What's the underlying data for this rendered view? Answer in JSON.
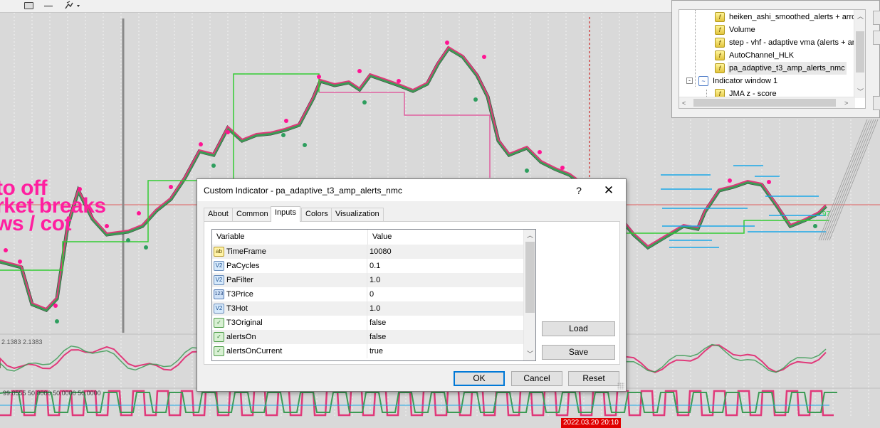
{
  "toolbar": {
    "icons": [
      "window-icon",
      "minus-icon",
      "drawing-tools-icon"
    ],
    "tools_label": "▾"
  },
  "chart": {
    "overlay_lines": [
      "to off",
      "rket breaks",
      "ws / cot"
    ],
    "osc_label": "2.1383 2.1383",
    "osc2_label": "99.0555 50.0000 50.0000 50.0000",
    "date_badge": "2022.03.20 20:10",
    "price_tag": "97",
    "colors": {
      "background": "#d9d9d9",
      "candle": "#000000",
      "ma_green": "#3c9b55",
      "ma_pink": "#e0397a",
      "step_green": "#33cc33",
      "step_pink": "#e060a0",
      "dots_pink": "#ff1493",
      "dots_green": "#2e9e5e",
      "levels_cyan": "#1aa7e8",
      "session_line": "#cc0000"
    }
  },
  "navigator": {
    "items": [
      {
        "label": "heiken_ashi_smoothed_alerts + arrows",
        "icon": "indicator-icon"
      },
      {
        "label": "Volume",
        "icon": "indicator-icon"
      },
      {
        "label": "step - vhf - adaptive vma (alerts + arrows)",
        "icon": "indicator-icon"
      },
      {
        "label": "AutoChannel_HLK",
        "icon": "indicator-icon"
      },
      {
        "label": "pa_adaptive_t3_amp_alerts_nmc",
        "icon": "indicator-icon"
      },
      {
        "label": "Indicator window 1",
        "icon": "window-icon"
      },
      {
        "label": "JMA  z - score",
        "icon": "indicator-icon"
      }
    ]
  },
  "dialog": {
    "title": "Custom Indicator - pa_adaptive_t3_amp_alerts_nmc",
    "help": "?",
    "close": "✕",
    "tabs": [
      "About",
      "Common",
      "Inputs",
      "Colors",
      "Visualization"
    ],
    "active_tab": "Inputs",
    "grid": {
      "col_variable": "Variable",
      "col_value": "Value",
      "rows": [
        {
          "name": "TimeFrame",
          "value": "10080",
          "type": "ab"
        },
        {
          "name": "PaCycles",
          "value": "0.1",
          "type": "dbl"
        },
        {
          "name": "PaFilter",
          "value": "1.0",
          "type": "dbl"
        },
        {
          "name": "T3Price",
          "value": "0",
          "type": "int"
        },
        {
          "name": "T3Hot",
          "value": "1.0",
          "type": "dbl"
        },
        {
          "name": "T3Original",
          "value": "false",
          "type": "bool"
        },
        {
          "name": "alertsOn",
          "value": "false",
          "type": "bool"
        },
        {
          "name": "alertsOnCurrent",
          "value": "true",
          "type": "bool"
        }
      ],
      "type_glyphs": {
        "ab": "ab",
        "dbl": "V2",
        "int": "123",
        "bool": "✓"
      }
    },
    "load": "Load",
    "save": "Save",
    "ok": "OK",
    "cancel": "Cancel",
    "reset": "Reset"
  }
}
